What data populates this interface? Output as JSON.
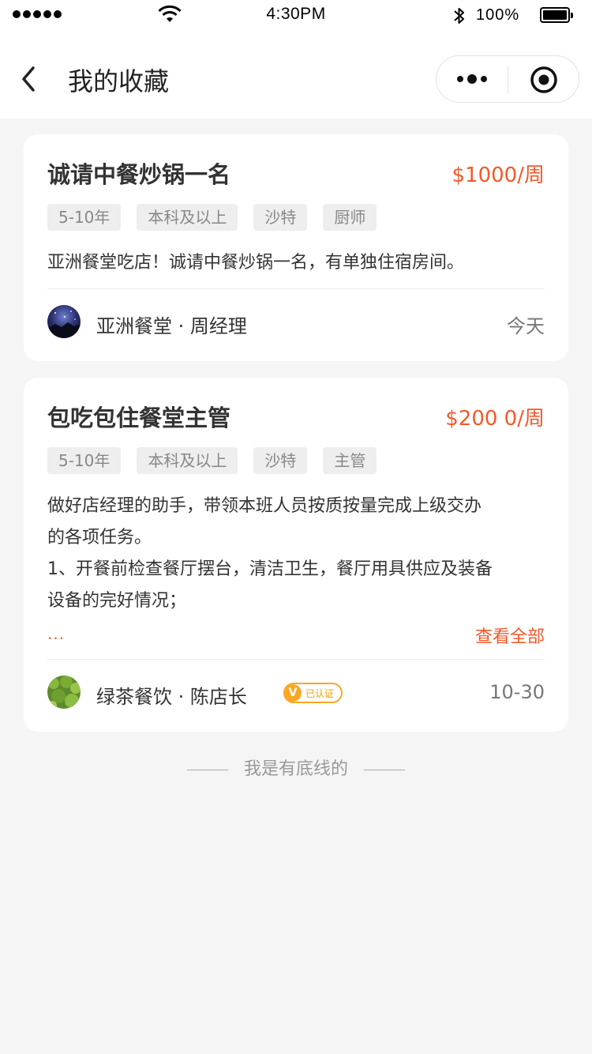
{
  "status_bar": {
    "time": "4:30PM",
    "battery": "100%"
  },
  "nav": {
    "title": "我的收藏"
  },
  "jobs": [
    {
      "title": "诚请中餐炒锅一名",
      "salary": "$1000/周",
      "tags": [
        "5-10年",
        "本科及以上",
        "沙特",
        "厨师"
      ],
      "description": "亚洲餐堂吃店！诚请中餐炒锅一名，有单独住宿房间。",
      "poster": "亚洲餐堂 · 周经理",
      "date": "今天"
    },
    {
      "title": "包吃包住餐堂主管",
      "salary": "$200 0/周",
      "tags": [
        "5-10年",
        "本科及以上",
        "沙特",
        "主管"
      ],
      "description_lines": [
        "做好店经理的助手，带领本班人员按质按量完成上级交办",
        "的各项任务。",
        "1、开餐前检查餐厅摆台，清洁卫生，餐厅用具供应及装备",
        "设备的完好情况；"
      ],
      "ellipsis": "...",
      "view_all": "查看全部",
      "poster": "绿茶餐饮 · 陈店长",
      "verified_label": "已认证",
      "date": "10-30"
    }
  ],
  "footer": "我是有底线的",
  "colors": {
    "accent": "#f15a2b",
    "verified": "#f9a825",
    "background": "#f5f5f5"
  },
  "icons": [
    "back-icon",
    "more-icon",
    "target-icon",
    "wifi-icon",
    "bluetooth-icon",
    "battery-icon",
    "verified-icon"
  ]
}
